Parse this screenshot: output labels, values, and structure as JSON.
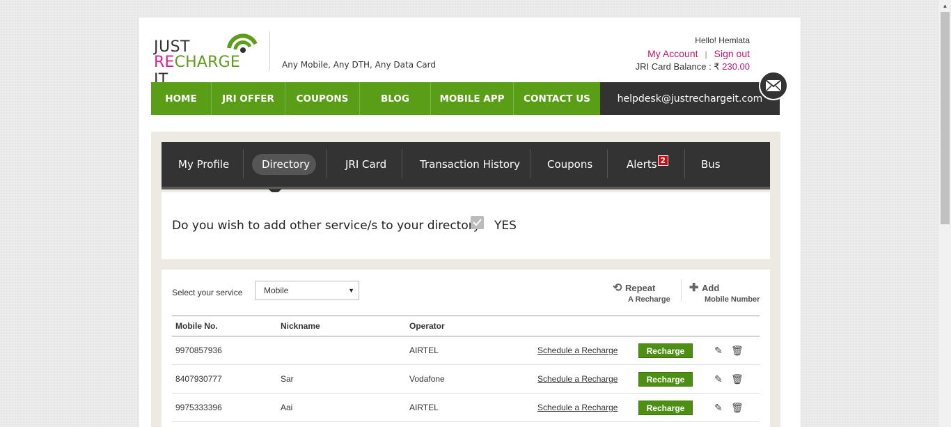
{
  "brand": {
    "logo_line1": "JUST",
    "logo_re": "RE",
    "logo_charge": "CHARGE",
    "logo_it": "IT",
    "tagline": "Any Mobile, Any DTH, Any Data Card"
  },
  "account": {
    "greeting": "Hello! Hemlata",
    "my_account": "My Account",
    "separator": "|",
    "sign_out": "Sign out",
    "balance_label": "JRI Card Balance :",
    "currency": "₹",
    "balance": "230.00"
  },
  "main_nav": [
    {
      "label": "HOME"
    },
    {
      "label": "JRI OFFER"
    },
    {
      "label": "COUPONS"
    },
    {
      "label": "BLOG"
    },
    {
      "label": "MOBILE APP"
    },
    {
      "label": "CONTACT US"
    }
  ],
  "helpdesk": "helpdesk@justrechargeit.com",
  "sub_nav": {
    "tabs": [
      {
        "label": "My Profile"
      },
      {
        "label": "Directory"
      },
      {
        "label": "JRI Card"
      },
      {
        "label": "Transaction History"
      },
      {
        "label": "Coupons"
      },
      {
        "label": "Alerts"
      },
      {
        "label": "Bus"
      }
    ],
    "active": "Directory",
    "alerts_badge": "2"
  },
  "question": {
    "text": "Do you wish to add other service/s to your directory:",
    "yes": "YES",
    "checked": true
  },
  "service": {
    "label": "Select your service",
    "selected": "Mobile"
  },
  "actions": {
    "repeat_title": "Repeat",
    "repeat_sub": "A Recharge",
    "add_title": "Add",
    "add_sub": "Mobile Number"
  },
  "table": {
    "headers": {
      "mobile": "Mobile No.",
      "nickname": "Nickname",
      "operator": "Operator"
    },
    "schedule_label": "Schedule a Recharge",
    "recharge_label": "Recharge",
    "rows": [
      {
        "mobile": "9970857936",
        "nickname": "",
        "operator": "AIRTEL"
      },
      {
        "mobile": "8407930777",
        "nickname": "Sar",
        "operator": "Vodafone"
      },
      {
        "mobile": "9975333396",
        "nickname": "Aai",
        "operator": "AIRTEL"
      }
    ]
  },
  "colors": {
    "nav_green": "#5a9e18",
    "accent_pink": "#c8166f",
    "dark": "#333333",
    "button_green": "#4d8f12"
  }
}
